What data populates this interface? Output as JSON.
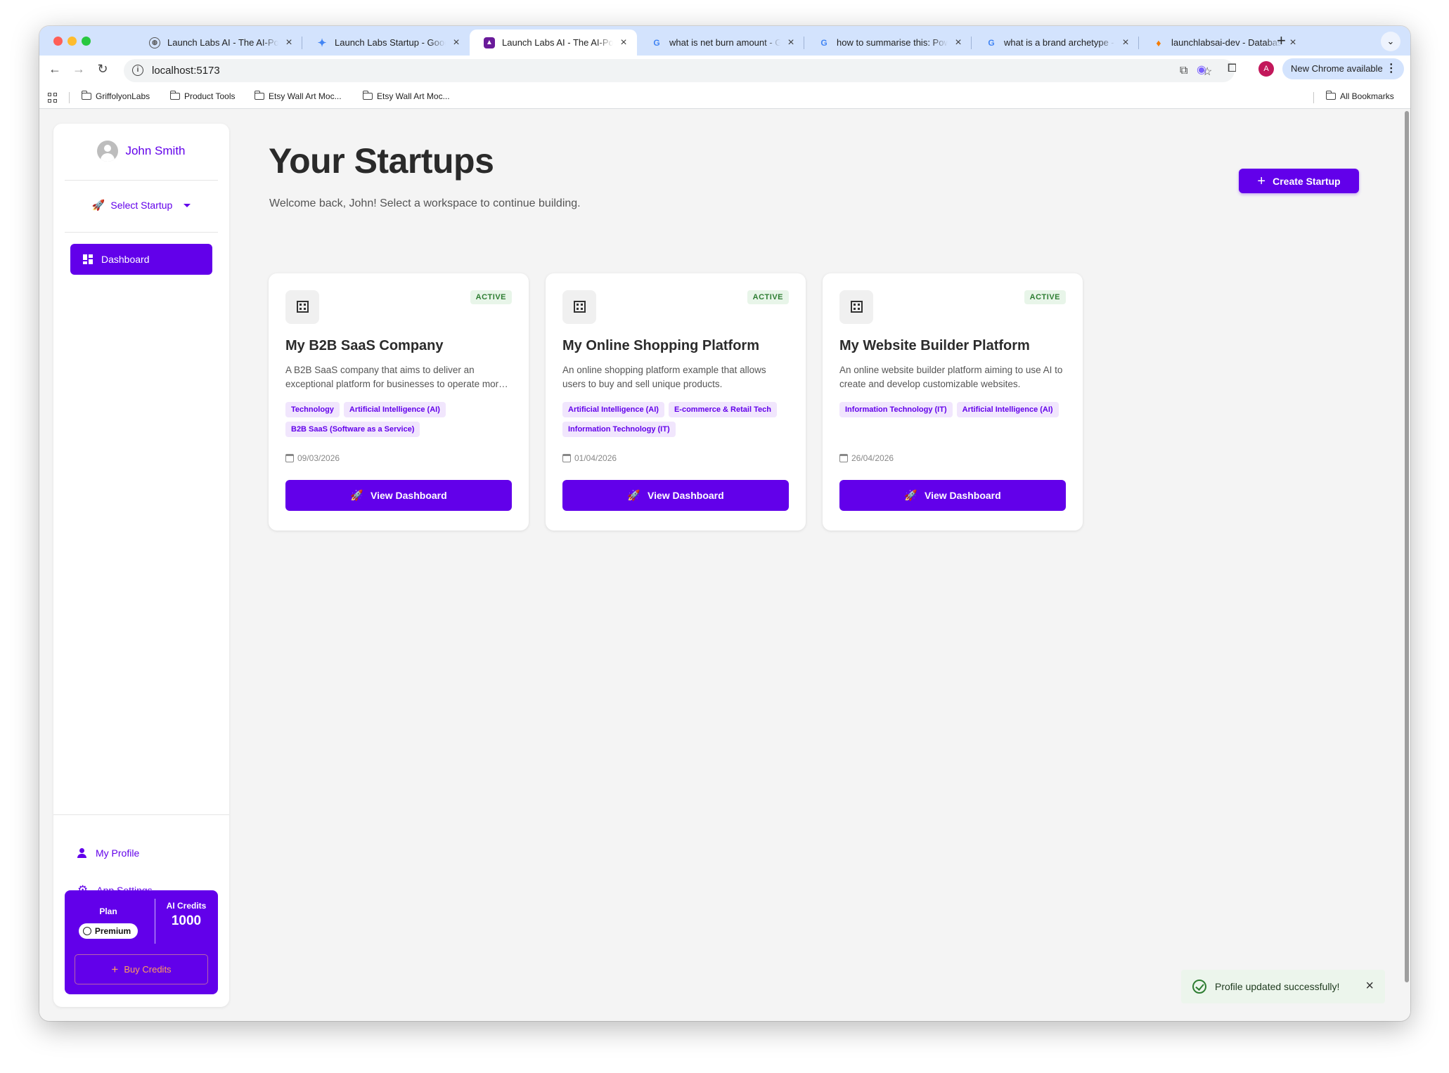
{
  "browser": {
    "tabs": [
      {
        "title": "Launch Labs AI - The AI-Powered Startup",
        "icon": "globe-icon",
        "active": false
      },
      {
        "title": "Launch Labs Startup - Google Gemini",
        "icon": "gemini-icon",
        "active": false
      },
      {
        "title": "Launch Labs AI - The AI-Powered Startup",
        "icon": "launchlabs-icon",
        "active": true
      },
      {
        "title": "what is net burn amount - Google Search",
        "icon": "google-icon",
        "active": false
      },
      {
        "title": "how to summarise this: Power Search",
        "icon": "google-icon",
        "active": false
      },
      {
        "title": "what is a brand archetype - Google Search",
        "icon": "google-icon",
        "active": false
      },
      {
        "title": "launchlabsai-dev - Database",
        "icon": "firebase-icon",
        "active": false
      }
    ],
    "url": "localhost:5173",
    "update_label": "New Chrome available",
    "profile_initial": "A",
    "bookmarks": [
      "GriffolyonLabs",
      "Product Tools",
      "Etsy Wall Art Moc...",
      "Etsy Wall Art Moc..."
    ],
    "all_bookmarks_label": "All Bookmarks"
  },
  "sidebar": {
    "user_name": "John Smith",
    "select_startup_label": "Select Startup",
    "nav": [
      {
        "label": "Dashboard",
        "icon": "dashboard-icon"
      }
    ],
    "my_profile_label": "My Profile",
    "app_settings_label": "App Settings",
    "plan_label": "Plan",
    "plan_value": "Premium",
    "credits_label": "AI Credits",
    "credits_value": "1000",
    "buy_credits_label": "Buy Credits"
  },
  "main": {
    "title": "Your Startups",
    "subtitle": "Welcome back, John! Select a workspace to continue building.",
    "create_label": "Create Startup"
  },
  "startups": [
    {
      "name": "My B2B SaaS Company",
      "status": "ACTIVE",
      "description": "A B2B SaaS company that aims to deliver an exceptional platform for businesses to operate more efficiently.",
      "tags": [
        "Technology",
        "Artificial Intelligence (AI)",
        "B2B SaaS (Software as a Service)"
      ],
      "date": "09/03/2026",
      "button_label": "View Dashboard"
    },
    {
      "name": "My Online Shopping Platform",
      "status": "ACTIVE",
      "description": "An online shopping platform example that allows users to buy and sell unique products.",
      "tags": [
        "Artificial Intelligence (AI)",
        "E-commerce & Retail Tech",
        "Information Technology (IT)"
      ],
      "date": "01/04/2026",
      "button_label": "View Dashboard"
    },
    {
      "name": "My Website Builder Platform",
      "status": "ACTIVE",
      "description": "An online website builder platform aiming to use AI to create and develop customizable websites.",
      "tags": [
        "Information Technology (IT)",
        "Artificial Intelligence (AI)"
      ],
      "date": "26/04/2026",
      "button_label": "View Dashboard"
    }
  ],
  "toast": {
    "message": "Profile updated successfully!"
  },
  "colors": {
    "accent": "#6200ea",
    "status_green": "#2e7d32",
    "page_bg": "#f4f4f4"
  }
}
